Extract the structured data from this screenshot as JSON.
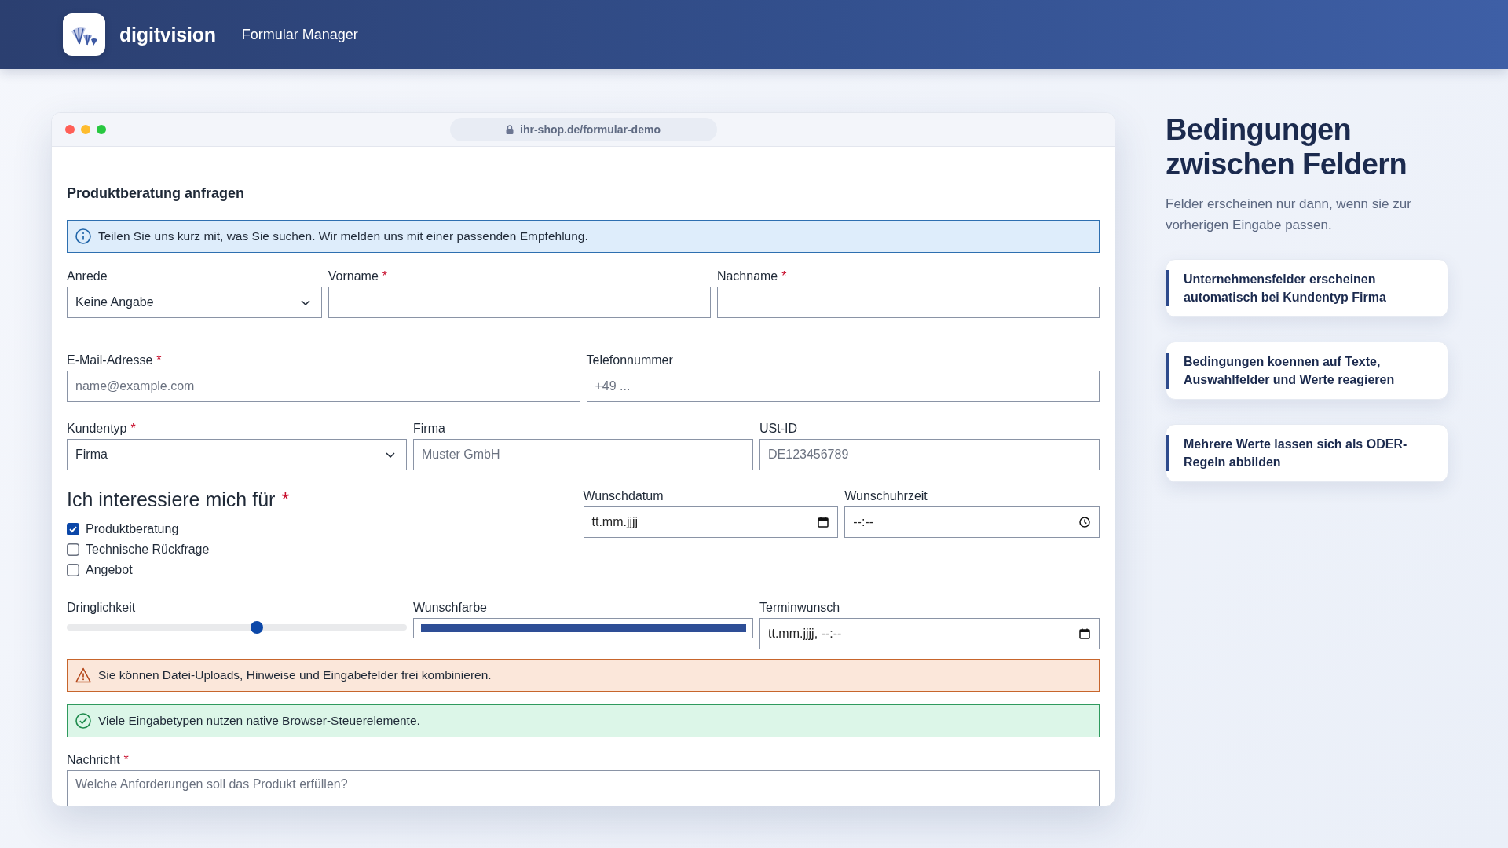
{
  "header": {
    "brand": "digitvision",
    "product": "Formular Manager"
  },
  "browser": {
    "url": "ihr-shop.de/formular-demo"
  },
  "form": {
    "title": "Produktberatung anfragen",
    "sections": [
      {
        "kind": "info_alert",
        "text": "Teilen Sie uns kurz mit, was Sie suchen. Wir melden uns mit einer passenden Empfehlung."
      },
      {
        "kind": "row",
        "fields": [
          {
            "kind": "select",
            "label": "Anrede",
            "value": "Keine Angabe"
          },
          {
            "kind": "text",
            "label": "Vorname",
            "required_mark": "*"
          },
          {
            "kind": "text",
            "label": "Nachname",
            "required_mark": "*"
          }
        ]
      },
      {
        "kind": "row",
        "fields": [
          {
            "kind": "text",
            "label": "E-Mail-Adresse",
            "required_mark": "*",
            "placeholder": "name@example.com"
          },
          {
            "kind": "text",
            "label": "Telefonnummer",
            "placeholder": "+49 ..."
          }
        ]
      },
      {
        "kind": "row",
        "fields": [
          {
            "kind": "select",
            "label": "Kundentyp",
            "required_mark": "*",
            "value": "Firma"
          },
          {
            "kind": "text",
            "label": "Firma",
            "placeholder": "Muster GmbH"
          },
          {
            "kind": "text",
            "label": "USt-ID",
            "placeholder": "DE123456789"
          }
        ]
      },
      {
        "kind": "row",
        "fields": [
          {
            "kind": "checkbox_group",
            "label": "Ich interessiere mich für",
            "required_mark": "*",
            "options": [
              {
                "label": "Produktberatung",
                "checked": true
              },
              {
                "label": "Technische Rückfrage",
                "checked": false
              },
              {
                "label": "Angebot",
                "checked": false
              }
            ]
          },
          {
            "kind": "date",
            "label": "Wunschdatum",
            "placeholder": "tt.mm.jjjj"
          },
          {
            "kind": "time",
            "label": "Wunschuhrzeit",
            "placeholder": "--:--"
          }
        ]
      },
      {
        "kind": "row",
        "fields": [
          {
            "kind": "range",
            "label": "Dringlichkeit",
            "level": 0.56
          },
          {
            "kind": "color",
            "label": "Wunschfarbe",
            "color": "#2e4e96"
          },
          {
            "kind": "datetime",
            "label": "Terminwunsch",
            "placeholder": "tt.mm.jjjj, --:--"
          }
        ]
      },
      {
        "kind": "warning_alert",
        "text": "Sie können Datei-Uploads, Hinweise und Eingabefelder frei kombinieren."
      },
      {
        "kind": "success_alert",
        "text": "Viele Eingabetypen nutzen native Browser-Steuerelemente."
      },
      {
        "kind": "row",
        "fields": [
          {
            "kind": "textarea",
            "label": "Nachricht",
            "required_mark": "*",
            "placeholder": "Welche Anforderungen soll das Produkt erfüllen?"
          }
        ]
      }
    ]
  },
  "aside": {
    "title": "Bedingungen zwischen Feldern",
    "text": "Felder erscheinen nur dann, wenn sie zur vorherigen Eingabe passen.",
    "cards": [
      "Unternehmensfelder erscheinen automatisch bei Kundentyp Firma",
      "Bedingungen koennen auf Texte, Auswahlfelder und Werte reagieren",
      "Mehrere Werte lassen sich als ODER-Regeln abbilden"
    ]
  }
}
